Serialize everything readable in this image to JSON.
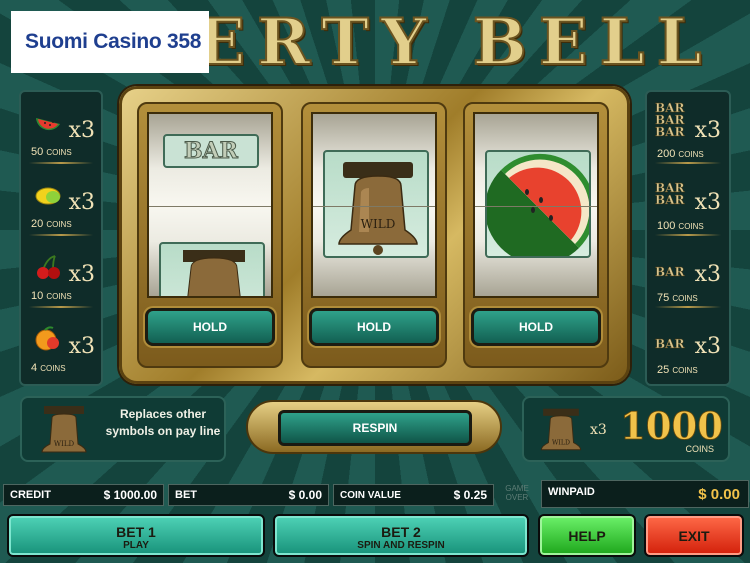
{
  "brand": "Suomi Casino 358",
  "title": "ERTY BELL",
  "paytable_left": [
    {
      "icon": "watermelon-icon",
      "mult": "x3",
      "coins": "50",
      "unit": "COINS"
    },
    {
      "icon": "lemon-icon",
      "mult": "x3",
      "coins": "20",
      "unit": "COINS"
    },
    {
      "icon": "cherry-icon",
      "mult": "x3",
      "coins": "10",
      "unit": "COINS"
    },
    {
      "icon": "orange-icon",
      "mult": "x3",
      "coins": "4",
      "unit": "COINS"
    }
  ],
  "paytable_right": [
    {
      "bars": [
        "BAR",
        "BAR",
        "BAR"
      ],
      "mult": "x3",
      "coins": "200",
      "unit": "COINS"
    },
    {
      "bars": [
        "BAR",
        "BAR"
      ],
      "mult": "x3",
      "coins": "100",
      "unit": "COINS"
    },
    {
      "bars": [
        "BAR"
      ],
      "mult": "x3",
      "coins": "75",
      "unit": "COINS"
    },
    {
      "bars": [
        "BAR"
      ],
      "mult": "x3",
      "coins": "25",
      "unit": "COINS"
    }
  ],
  "reels": [
    {
      "top_symbol": "BAR",
      "main_symbol": "bell-wild",
      "hold_label": "HOLD"
    },
    {
      "main_symbol": "bell-wild",
      "hold_label": "HOLD"
    },
    {
      "main_symbol": "watermelon",
      "hold_label": "HOLD"
    }
  ],
  "wild_text": "WILD",
  "wild_info": "Replaces other symbols on pay line",
  "respin_label": "RESPIN",
  "jackpot": {
    "mult": "x3",
    "amount": "1000",
    "unit": "COINS"
  },
  "status": {
    "credit_label": "CREDIT",
    "credit_value": "$ 1000.00",
    "bet_label": "BET",
    "bet_value": "$ 0.00",
    "coin_label": "COIN VALUE",
    "coin_value": "$ 0.25",
    "game_over": "GAME OVER",
    "winpaid_label": "WINPAID",
    "winpaid_value": "$ 0.00"
  },
  "buttons": {
    "bet1_title": "BET 1",
    "bet1_sub": "PLAY",
    "bet2_title": "BET 2",
    "bet2_sub": "SPIN AND RESPIN",
    "help": "HELP",
    "exit": "EXIT"
  },
  "colors": {
    "accent_gold": "#f1c24a",
    "panel_teal": "#179179",
    "help_green": "#1da51b",
    "exit_red": "#d21f0a"
  }
}
